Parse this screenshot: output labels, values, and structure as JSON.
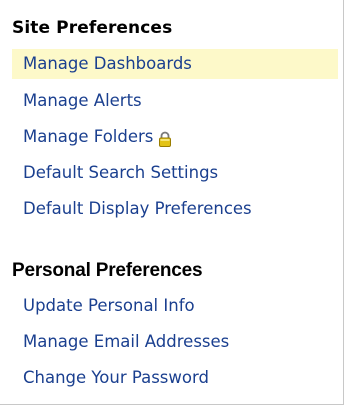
{
  "site_preferences": {
    "heading": "Site Preferences",
    "items": [
      {
        "label": "Manage Dashboards"
      },
      {
        "label": "Manage Alerts"
      },
      {
        "label": "Manage Folders",
        "icon": "lock-icon"
      },
      {
        "label": "Default Search Settings"
      },
      {
        "label": "Default Display Preferences"
      }
    ]
  },
  "personal_preferences": {
    "heading": "Personal Preferences",
    "items": [
      {
        "label": "Update Personal Info"
      },
      {
        "label": "Manage Email Addresses"
      },
      {
        "label": "Change Your Password"
      }
    ]
  },
  "colors": {
    "link": "#1a3f8f",
    "highlight": "#fdf9c9",
    "border": "#c8c8c8",
    "lock_icon": "#d6b400"
  }
}
